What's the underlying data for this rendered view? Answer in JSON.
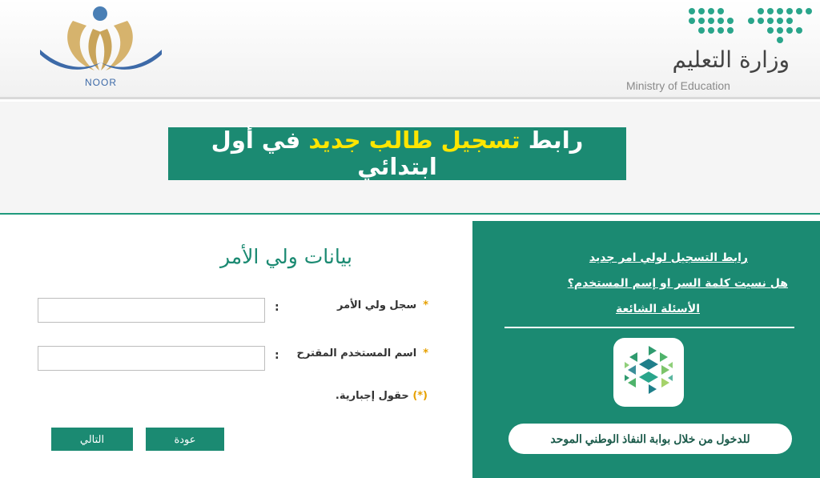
{
  "header": {
    "noor_logo_text": "NOOR",
    "ministry_name_ar": "وزارة التعليم",
    "ministry_name_en": "Ministry of Education"
  },
  "banner": {
    "part1": "رابط",
    "part2": "تسجيل طالب جديد",
    "part3": "في أول",
    "part4": "ابتدائي"
  },
  "side_panel": {
    "link_register_guardian": "رابط التسجيل لولي امر جديد",
    "link_forgot": "هل نسيت كلمة السر او إسم المستخدم؟",
    "link_faq": "الأسئلة الشائعة",
    "nafath_button": "للدخول من خلال بوابة النفاذ الوطني الموحد"
  },
  "form": {
    "title": "بيانات ولي الأمر",
    "fields": [
      {
        "label": "سجل ولي الأمر",
        "value": ""
      },
      {
        "label": "اسم المستخدم المقترح",
        "value": ""
      }
    ],
    "required_star": "*",
    "colon": ":",
    "mandatory_note_star": "(*)",
    "mandatory_note_text": "حقول إجبارية.",
    "back_button": "عودة",
    "next_button": "التالي"
  },
  "colors": {
    "primary_green": "#1b8a72",
    "banner_highlight": "#ffe600",
    "required_star": "#e6a000"
  }
}
